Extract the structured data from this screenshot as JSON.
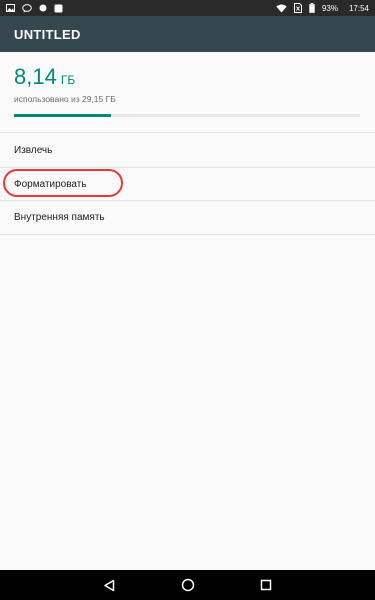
{
  "status_bar": {
    "battery": "93%",
    "time": "17:54",
    "left_icons": [
      "image-icon",
      "chat-bubble-icon",
      "notification-dot-icon",
      "square-app-icon"
    ],
    "right_icons": [
      "wifi-icon",
      "no-sim-icon",
      "battery-icon"
    ]
  },
  "app_bar": {
    "title": "UNTITLED",
    "background": "#37474f"
  },
  "storage": {
    "used_amount": "8,14",
    "used_unit": "ГБ",
    "used_of": "использовано из 29,15 ГБ",
    "progress_fraction": 0.28,
    "accent": "#00897b"
  },
  "menu": {
    "items": [
      {
        "label": "Извлечь"
      },
      {
        "label": "Форматировать",
        "highlighted": true
      },
      {
        "label": "Внутренняя память"
      }
    ]
  },
  "annotation": {
    "ring_color": "#e53935"
  },
  "nav_bar": {
    "buttons": [
      "back-icon",
      "home-icon",
      "recents-icon"
    ]
  }
}
